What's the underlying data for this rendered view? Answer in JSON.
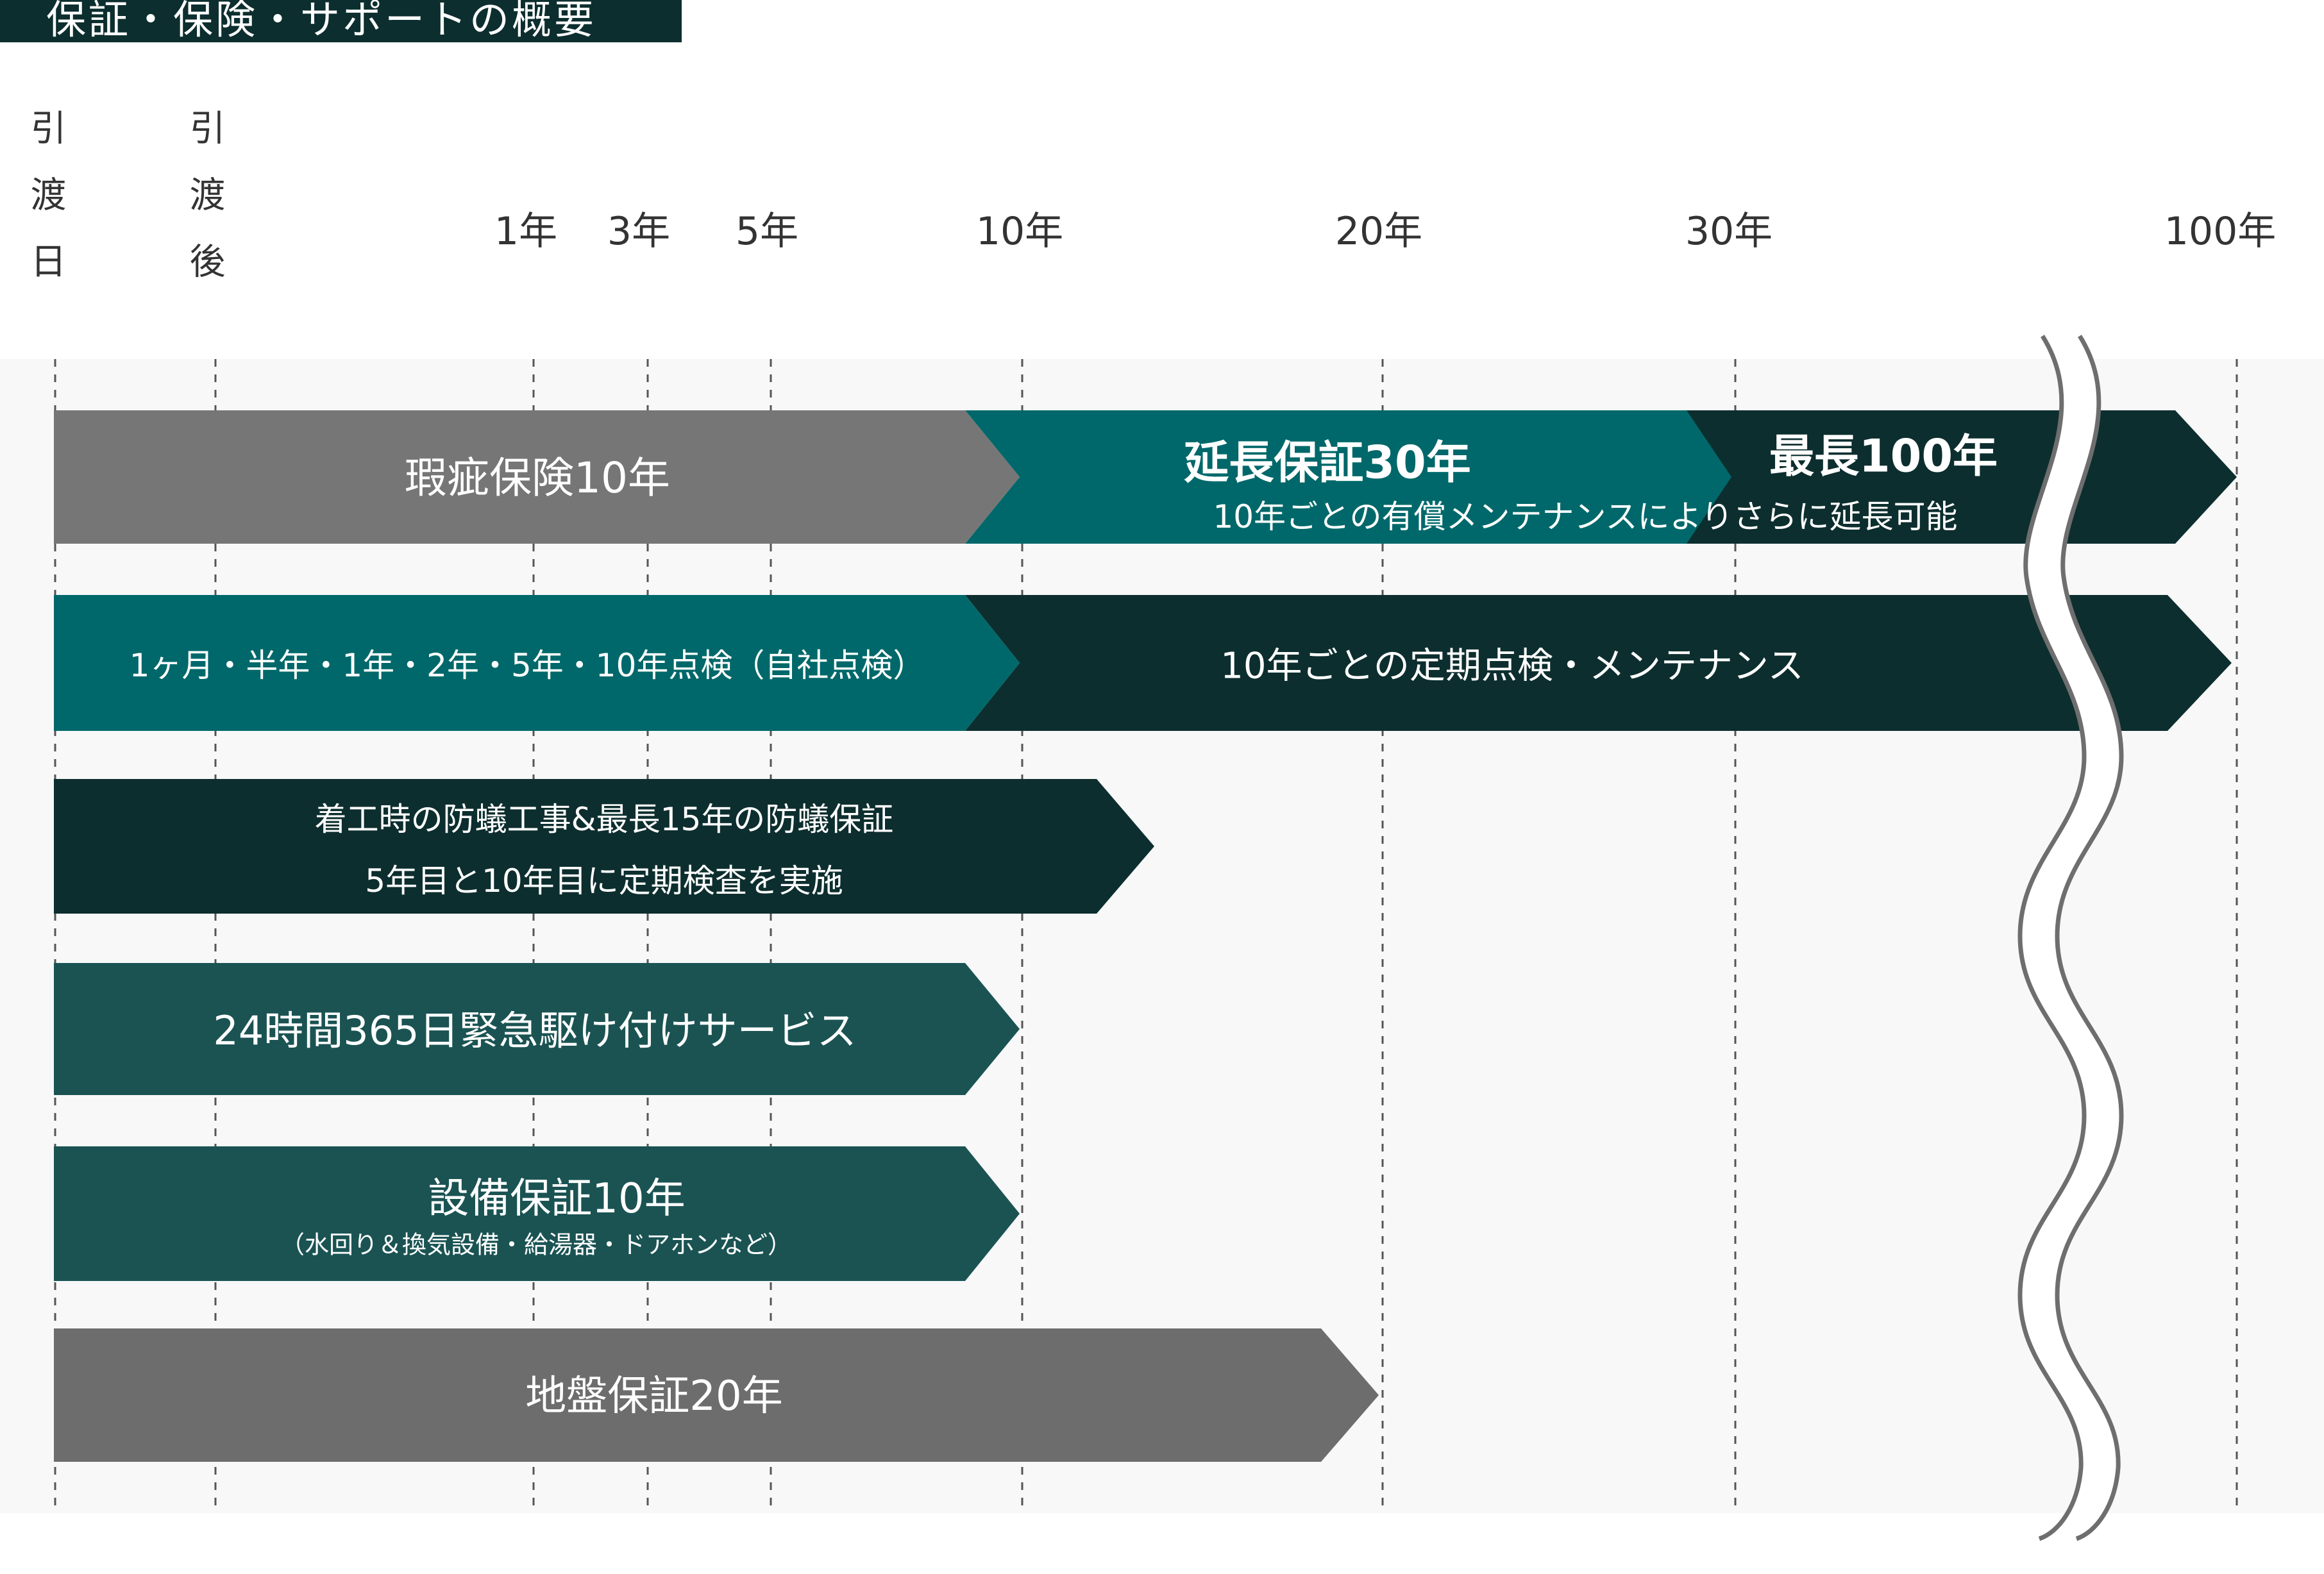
{
  "title": "保証・保険・サポートの概要",
  "phases": [
    {
      "label": "引渡日"
    },
    {
      "label": "引渡後"
    }
  ],
  "timeline": [
    "1年",
    "3年",
    "5年",
    "10年",
    "20年",
    "30年",
    "100年"
  ],
  "bars": [
    {
      "label": "瑕疵保険10年"
    },
    {
      "label": "延長保証30年",
      "sub": "10年ごとの有償メンテナンスによりさらに延長可能"
    },
    {
      "label": "最長100年"
    },
    {
      "label": "1ヶ月・半年・1年・2年・5年・10年点検（自社点検）"
    },
    {
      "label": "10年ごとの定期点検・メンテナンス"
    },
    {
      "label": "着工時の防蟻工事&最長15年の防蟻保証",
      "sub": "5年目と10年目に定期検査を実施"
    },
    {
      "label": "24時間365日緊急駆け付けサービス"
    },
    {
      "label": "設備保証10年",
      "sub": "（水回り＆換気設備・給湯器・ドアホンなど）"
    },
    {
      "label": "地盤保証20年"
    }
  ],
  "colors": {
    "gray": "#767676",
    "gray_dark": "#6d6d6d",
    "teal": "#00686a",
    "dark": "#0d2e2e",
    "deep_teal": "#1b5353"
  }
}
